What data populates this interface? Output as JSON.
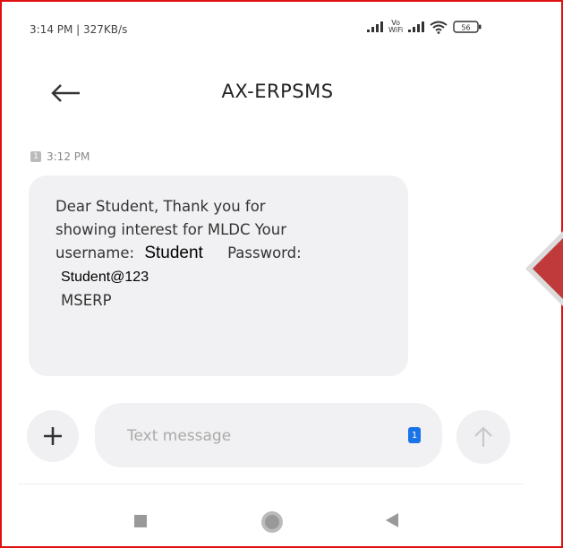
{
  "status_bar": {
    "time_text": "3:14 PM | 327KB/s",
    "vowifi_top": "Vo",
    "vowifi_bottom": "WiFi",
    "battery_level": "56"
  },
  "header": {
    "title": "AX-ERPSMS"
  },
  "message": {
    "sim_slot": "1",
    "time": "3:12 PM",
    "lines": [
      "Dear Student, Thank you for",
      "showing interest for MLDC Your",
      "username:",
      "Password:",
      "MSERP"
    ],
    "username_value": "Student",
    "password_value": "Student@123"
  },
  "composer": {
    "placeholder": "Text message",
    "sim_label": "1"
  },
  "colors": {
    "frame_border": "#e01010",
    "bubble_bg": "#f1f1f3",
    "sim_blue": "#1a73e8",
    "side_marker": "#c0393b"
  }
}
